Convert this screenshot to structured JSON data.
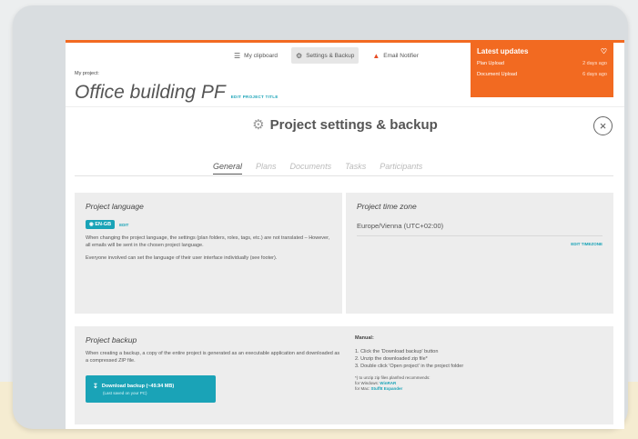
{
  "header": {
    "nav": [
      {
        "label": "My clipboard",
        "icon": "clipboard-icon"
      },
      {
        "label": "Settings & Backup",
        "icon": "gear-icon",
        "active": true
      },
      {
        "label": "Email Notifier",
        "icon": "bell-icon"
      }
    ],
    "project_label": "My project:",
    "project_title": "Office building PF",
    "edit_title_label": "EDIT PROJECT TITLE"
  },
  "updates": {
    "title": "Latest updates",
    "items": [
      {
        "name": "Plan Upload",
        "time": "2 days ago"
      },
      {
        "name": "Document Upload",
        "time": "6 days ago"
      }
    ]
  },
  "modal": {
    "title": "Project settings & backup",
    "close_symbol": "×"
  },
  "tabs": [
    "General",
    "Plans",
    "Documents",
    "Tasks",
    "Participants"
  ],
  "language": {
    "heading": "Project language",
    "badge": "EN-GB",
    "edit_label": "EDIT",
    "text1": "When changing the project language, the settings (plan folders, roles, tags, etc.) are not translated – However, all emails will be sent in the chosen project language.",
    "text2": "Everyone involved can set the language of their user interface individually (see footer)."
  },
  "timezone": {
    "heading": "Project time zone",
    "value": "Europe/Vienna (UTC+02:00)",
    "edit_label": "EDIT TIMEZONE"
  },
  "backup": {
    "heading": "Project backup",
    "text": "When creating a backup, a copy of the entire project is generated as an executable application and downloaded as a compressed ZIP file.",
    "button_label": "Download backup (~49.94 MB)",
    "button_sub": "(Last saved on your PC)",
    "manual_heading": "Manual:",
    "steps": [
      "1. Click the 'Download backup' button",
      "2. Unzip the downloaded zip file*",
      "3. Double click 'Open project' in the project folder"
    ],
    "footnote_intro": "*) to unzip zip files planfred recommends:",
    "footnote_windows": "for Windows:",
    "footnote_windows_link": "WinRAR",
    "footnote_mac": "for Mac:",
    "footnote_mac_link": "StuffIt Expander"
  },
  "colors": {
    "accent": "#f26a21",
    "teal": "#1aa3b7"
  }
}
